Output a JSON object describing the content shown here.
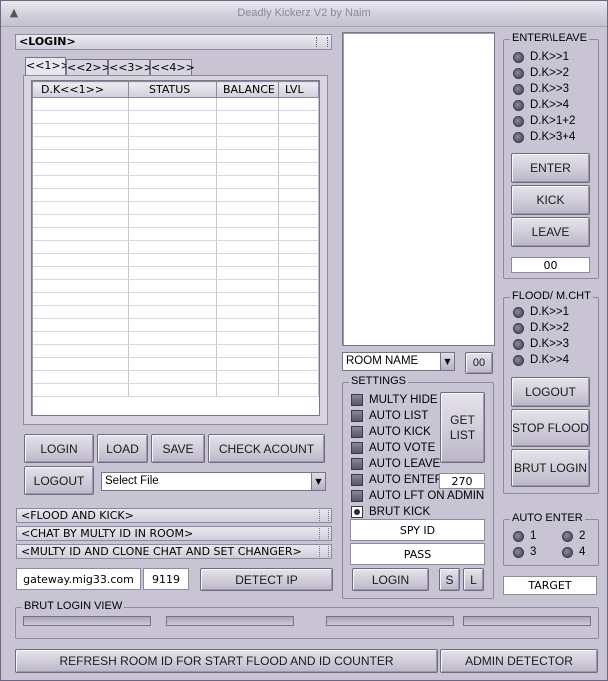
{
  "window": {
    "title": "Deadly Kickerz V2 by Naim"
  },
  "login_panel": {
    "header": "<LOGIN>",
    "tabs": [
      "<<1>>",
      "<<2>>",
      "<<3>>",
      "<<4>>"
    ],
    "columns": [
      "D.K<<1>>",
      "STATUS",
      "BALANCE",
      "LVL"
    ],
    "buttons": {
      "login": "LOGIN",
      "load": "LOAD",
      "save": "SAVE",
      "check_account": "CHECK ACOUNT",
      "logout": "LOGOUT"
    },
    "file_select": "Select File"
  },
  "collapsed_sections": [
    "<FLOOD AND KICK>",
    "<CHAT BY MULTY ID IN ROOM>",
    "<MULTY ID AND CLONE CHAT AND SET CHANGER>"
  ],
  "server": {
    "host": "gateway.mig33.com",
    "port": "9119",
    "detect_ip": "DETECT IP"
  },
  "room": {
    "name_placeholder": "ROOM NAME",
    "count": "00"
  },
  "settings": {
    "title": "SETTINGS",
    "options": [
      {
        "label": "MULTY HIDE",
        "checked": false
      },
      {
        "label": "AUTO LIST",
        "checked": false
      },
      {
        "label": "AUTO KICK",
        "checked": false
      },
      {
        "label": "AUTO VOTE",
        "checked": false
      },
      {
        "label": "AUTO LEAVE",
        "checked": false
      },
      {
        "label": "AUTO ENTER",
        "checked": false
      },
      {
        "label": "AUTO LFT ON ADMIN",
        "checked": false
      },
      {
        "label": "BRUT KICK",
        "checked": true
      }
    ],
    "auto_enter_value": "270",
    "get_list": "GET\nLIST",
    "spy_id": "SPY ID",
    "pass": "PASS",
    "login": "LOGIN",
    "s": "S",
    "l": "L"
  },
  "enter_leave": {
    "title": "ENTER\\LEAVE",
    "options": [
      "D.K>>1",
      "D.K>>2",
      "D.K>>3",
      "D.K>>4",
      "D.K>1+2",
      "D.K>3+4"
    ],
    "enter": "ENTER",
    "kick": "KICK",
    "leave": "LEAVE",
    "counter": "00"
  },
  "flood": {
    "title": "FLOOD/ M.CHT",
    "options": [
      "D.K>>1",
      "D.K>>2",
      "D.K>>3",
      "D.K>>4"
    ],
    "logout": "LOGOUT",
    "stop_flood": "STOP FLOOD",
    "brut_login": "BRUT LOGIN"
  },
  "auto_enter": {
    "title": "AUTO ENTER",
    "options": [
      "1",
      "2",
      "3",
      "4"
    ]
  },
  "target": "TARGET",
  "brut_login_view": {
    "title": "BRUT LOGIN VIEW"
  },
  "footer": {
    "refresh": "REFRESH ROOM ID FOR START FLOOD AND ID COUNTER",
    "admin_detector": "ADMIN DETECTOR"
  }
}
